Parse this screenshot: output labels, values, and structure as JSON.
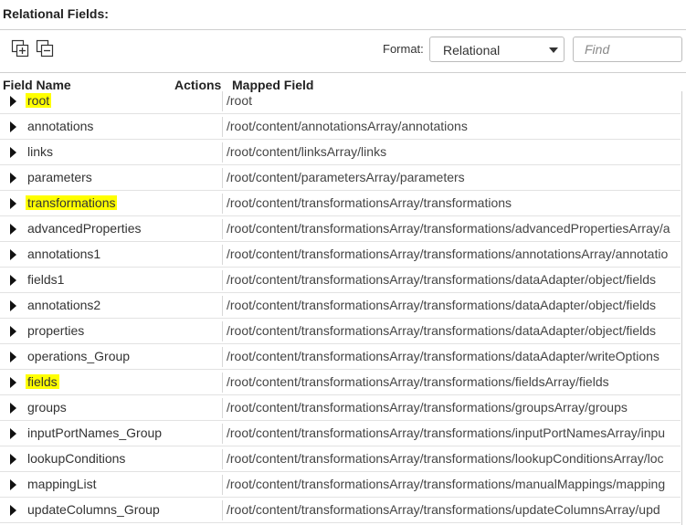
{
  "section_title": "Relational Fields:",
  "toolbar": {
    "expand_all_icon": "expand-all-icon",
    "collapse_all_icon": "collapse-all-icon",
    "format_label": "Format:",
    "format_value": "Relational",
    "find_placeholder": "Find"
  },
  "columns": {
    "field_name": "Field Name",
    "actions": "Actions",
    "mapped_field": "Mapped Field"
  },
  "colors": {
    "highlight": "#ffff00",
    "rule": "#e2e2e2"
  },
  "rows": [
    {
      "name": "root",
      "mapped": "/root",
      "highlighted": true
    },
    {
      "name": "annotations",
      "mapped": "/root/content/annotationsArray/annotations",
      "highlighted": false
    },
    {
      "name": "links",
      "mapped": "/root/content/linksArray/links",
      "highlighted": false
    },
    {
      "name": "parameters",
      "mapped": "/root/content/parametersArray/parameters",
      "highlighted": false
    },
    {
      "name": "transformations",
      "mapped": "/root/content/transformationsArray/transformations",
      "highlighted": true
    },
    {
      "name": "advancedProperties",
      "mapped": "/root/content/transformationsArray/transformations/advancedPropertiesArray/a",
      "highlighted": false
    },
    {
      "name": "annotations1",
      "mapped": "/root/content/transformationsArray/transformations/annotationsArray/annotatio",
      "highlighted": false
    },
    {
      "name": "fields1",
      "mapped": "/root/content/transformationsArray/transformations/dataAdapter/object/fields",
      "highlighted": false
    },
    {
      "name": "annotations2",
      "mapped": "/root/content/transformationsArray/transformations/dataAdapter/object/fields",
      "highlighted": false
    },
    {
      "name": "properties",
      "mapped": "/root/content/transformationsArray/transformations/dataAdapter/object/fields",
      "highlighted": false
    },
    {
      "name": "operations_Group",
      "mapped": "/root/content/transformationsArray/transformations/dataAdapter/writeOptions",
      "highlighted": false
    },
    {
      "name": "fields",
      "mapped": "/root/content/transformationsArray/transformations/fieldsArray/fields",
      "highlighted": true
    },
    {
      "name": "groups",
      "mapped": "/root/content/transformationsArray/transformations/groupsArray/groups",
      "highlighted": false
    },
    {
      "name": "inputPortNames_Group",
      "mapped": "/root/content/transformationsArray/transformations/inputPortNamesArray/inpu",
      "highlighted": false
    },
    {
      "name": "lookupConditions",
      "mapped": "/root/content/transformationsArray/transformations/lookupConditionsArray/loc",
      "highlighted": false
    },
    {
      "name": "mappingList",
      "mapped": "/root/content/transformationsArray/transformations/manualMappings/mapping",
      "highlighted": false
    },
    {
      "name": "updateColumns_Group",
      "mapped": "/root/content/transformationsArray/transformations/updateColumnsArray/upd",
      "highlighted": false
    }
  ]
}
